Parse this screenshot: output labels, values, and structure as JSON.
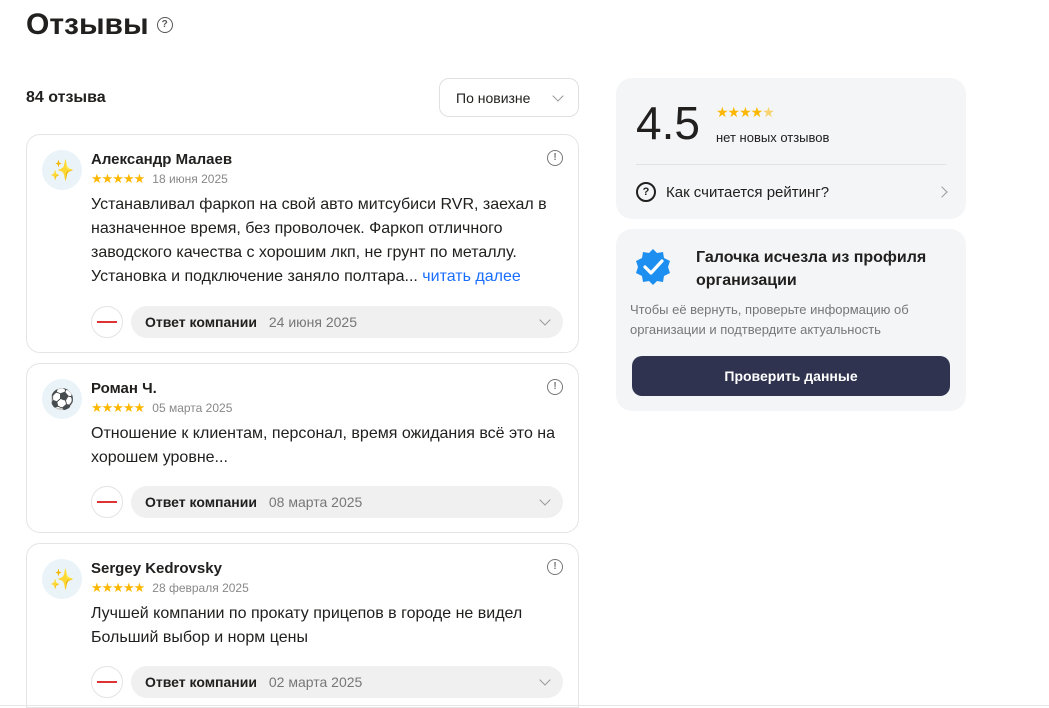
{
  "header": {
    "title": "Отзывы",
    "help_icon": "question-circle-icon"
  },
  "summary": {
    "count_label": "84 отзыва",
    "sort_label": "По новизне"
  },
  "reviews": [
    {
      "author": "Александр Малаев",
      "avatar_icon": "sparkles-icon",
      "rating": 5,
      "date": "18 июня 2025",
      "text": "Устанавливал фаркоп на свой авто митсубиси RVR, заехал в назначенное время, без проволочек. Фаркоп отличного заводского качества с хорошим лкп, не грунт по металлу. Установка и подключение заняло полтара...",
      "more_label": "читать далее",
      "reply_label": "Ответ компании",
      "reply_date": "24 июня 2025"
    },
    {
      "author": "Роман Ч.",
      "avatar_icon": "soccer-ball-icon",
      "rating": 5,
      "date": "05 марта 2025",
      "text": "Отношение к клиентам, персонал, время ожидания всё это на хорошем уровне...",
      "more_label": "",
      "reply_label": "Ответ компании",
      "reply_date": "08 марта 2025"
    },
    {
      "author": "Sergey Kedrovsky",
      "avatar_icon": "sparkles-icon",
      "rating": 5,
      "date": "28 февраля 2025",
      "text": "Лучшей компании по прокату прицепов в городе не видел Больший выбор и норм цены",
      "more_label": "",
      "reply_label": "Ответ компании",
      "reply_date": "02 марта 2025"
    }
  ],
  "rating": {
    "value": "4.5",
    "stars": 4.5,
    "status": "нет новых отзывов",
    "how_label": "Как считается рейтинг?"
  },
  "verification": {
    "title": "Галочка исчезла из профиля организации",
    "description": "Чтобы её вернуть, проверьте информацию об организации и подтвердите актуальность",
    "button_label": "Проверить данные"
  },
  "colors": {
    "star": "#fcb800",
    "link": "#196dff",
    "button": "#2f3350",
    "panel": "#f4f5f7"
  }
}
